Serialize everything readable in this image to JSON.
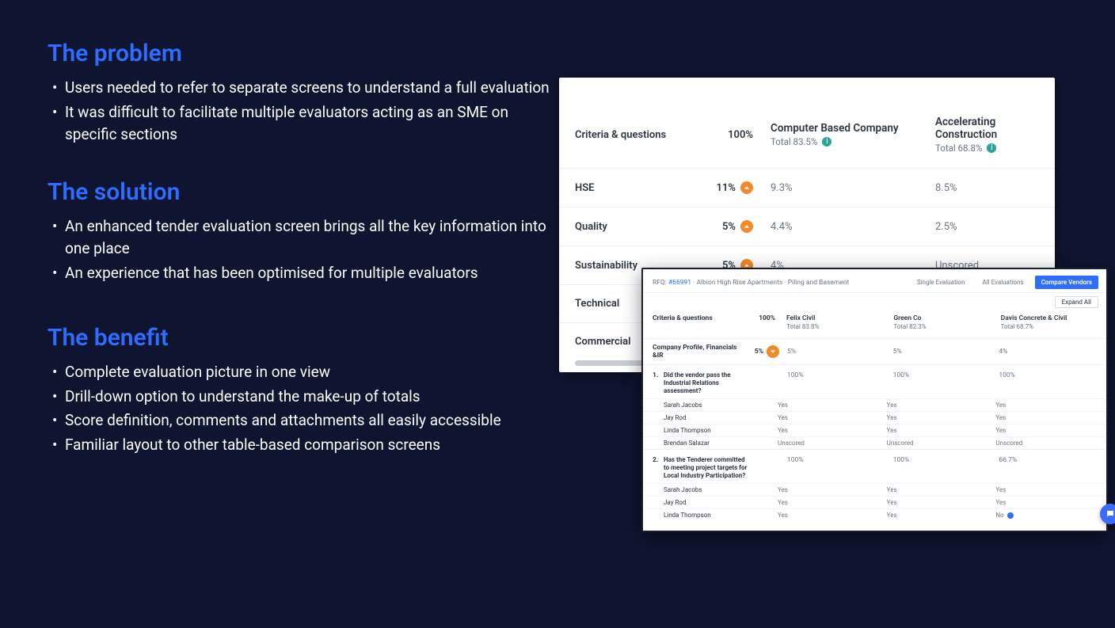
{
  "sections": {
    "problem": {
      "heading": "The problem",
      "bullets": [
        "Users needed to refer to separate screens to understand a full evaluation",
        "It was difficult to facilitate multiple evaluators acting as an SME on specific sections"
      ]
    },
    "solution": {
      "heading": "The solution",
      "bullets": [
        "An enhanced tender evaluation screen brings all the key information into one place",
        "An experience that has been optimised for multiple evaluators"
      ]
    },
    "benefit": {
      "heading": "The benefit",
      "bullets": [
        "Complete evaluation picture in one view",
        "Drill-down option to understand the make-up of totals",
        "Score definition, comments and attachments all easily accessible",
        "Familiar layout to other table-based comparison screens"
      ]
    }
  },
  "panel1": {
    "criteria_label": "Criteria & questions",
    "total_weight": "100%",
    "vendors": [
      {
        "name": "Computer Based Company",
        "total": "Total 83.5%"
      },
      {
        "name": "Accelerating Construction",
        "total": "Total 68.8%"
      }
    ],
    "rows": [
      {
        "name": "HSE",
        "weight": "11%",
        "v1": "9.3%",
        "v2": "8.5%"
      },
      {
        "name": "Quality",
        "weight": "5%",
        "v1": "4.4%",
        "v2": "2.5%"
      },
      {
        "name": "Sustainability",
        "weight": "5%",
        "v1": "4%",
        "v2": "Unscored"
      }
    ],
    "truncated": [
      {
        "name": "Technical"
      },
      {
        "name": "Commercial"
      }
    ]
  },
  "panel2": {
    "rfq_prefix": "RFQ:",
    "rfq_id": "#66991",
    "rfq_title": "· Albion High Rise Apartments · Piling and Basement",
    "tabs": [
      {
        "label": "Single Evaluation",
        "active": false
      },
      {
        "label": "All Evaluations",
        "active": false
      },
      {
        "label": "Compare Vendors",
        "active": true
      }
    ],
    "expand_label": "Expand All",
    "criteria_label": "Criteria & questions",
    "total_weight": "100%",
    "vendors": [
      {
        "name": "Felix Civil",
        "total": "Total 83.8%"
      },
      {
        "name": "Green Co",
        "total": "Total 82.3%"
      },
      {
        "name": "Davis Concrete & Civil",
        "total": "Total 68.7%"
      }
    ],
    "section": {
      "name": "Company Profile, Financials &IR",
      "weight": "5%",
      "v1": "5%",
      "v2": "5%",
      "v3": "4%"
    },
    "q1": {
      "num": "1.",
      "text": "Did the vendor pass the Industrial Relations assessment?",
      "v1": "100%",
      "v2": "100%",
      "v3": "100%",
      "evaluators": [
        {
          "name": "Sarah Jacobs",
          "v1": "Yes",
          "v2": "Yes",
          "v3": "Yes"
        },
        {
          "name": "Jay Rod",
          "v1": "Yes",
          "v2": "Yes",
          "v3": "Yes"
        },
        {
          "name": "Linda Thompson",
          "v1": "Yes",
          "v2": "Yes",
          "v3": "Yes"
        },
        {
          "name": "Brendan Salazar",
          "v1": "Unscored",
          "v2": "Unscored",
          "v3": "Unscored"
        }
      ]
    },
    "q2": {
      "num": "2.",
      "text": "Has the Tenderer committed to meeting project targets for Local Industry Participation?",
      "v1": "100%",
      "v2": "100%",
      "v3": "66.7%",
      "evaluators": [
        {
          "name": "Sarah Jacobs",
          "v1": "Yes",
          "v2": "Yes",
          "v3": "Yes"
        },
        {
          "name": "Jay Rod",
          "v1": "Yes",
          "v2": "Yes",
          "v3": "Yes"
        },
        {
          "name": "Linda Thompson",
          "v1": "Yes",
          "v2": "Yes",
          "v3": "No"
        }
      ]
    }
  }
}
